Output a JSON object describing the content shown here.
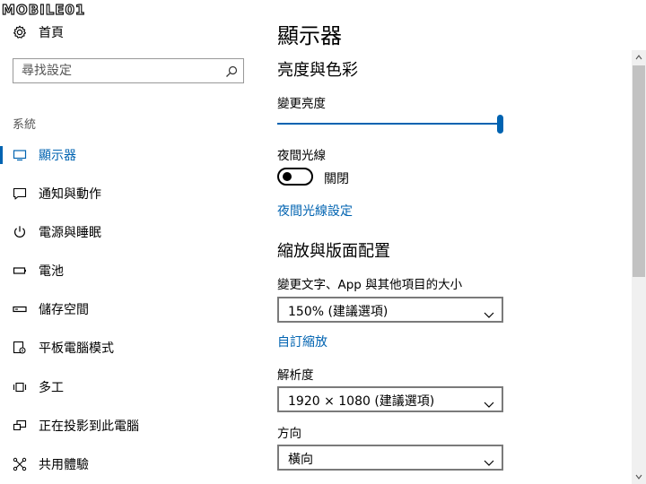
{
  "watermark": {
    "text": "MOBILE01"
  },
  "nav": {
    "home_label": "首頁",
    "search_placeholder": "尋找設定",
    "section_label": "系統",
    "items": [
      {
        "label": "顯示器",
        "icon": "monitor-icon",
        "active": true
      },
      {
        "label": "通知與動作",
        "icon": "message-icon",
        "active": false
      },
      {
        "label": "電源與睡眠",
        "icon": "power-icon",
        "active": false
      },
      {
        "label": "電池",
        "icon": "battery-icon",
        "active": false
      },
      {
        "label": "儲存空間",
        "icon": "storage-icon",
        "active": false
      },
      {
        "label": "平板電腦模式",
        "icon": "tablet-mode-icon",
        "active": false
      },
      {
        "label": "多工",
        "icon": "multitasking-icon",
        "active": false
      },
      {
        "label": "正在投影到此電腦",
        "icon": "projecting-icon",
        "active": false
      },
      {
        "label": "共用體驗",
        "icon": "shared-experiences-icon",
        "active": false
      }
    ]
  },
  "main": {
    "title": "顯示器",
    "brightness_section": "亮度與色彩",
    "brightness_label": "變更亮度",
    "brightness_value": 1.0,
    "night_light_label": "夜間光線",
    "night_light_state": "關閉",
    "night_light_on": false,
    "night_light_settings_link": "夜間光線設定",
    "scale_section": "縮放與版面配置",
    "scale_label": "變更文字、App 與其他項目的大小",
    "scale_value": "150% (建議選項)",
    "custom_scaling_link": "自訂縮放",
    "resolution_label": "解析度",
    "resolution_value": "1920 × 1080 (建議選項)",
    "orientation_label": "方向",
    "orientation_value": "橫向"
  },
  "colors": {
    "accent": "#0063b1",
    "scrollbar_thumb": "#c2c2c2",
    "scrollbar_track": "#f0f0f0"
  }
}
